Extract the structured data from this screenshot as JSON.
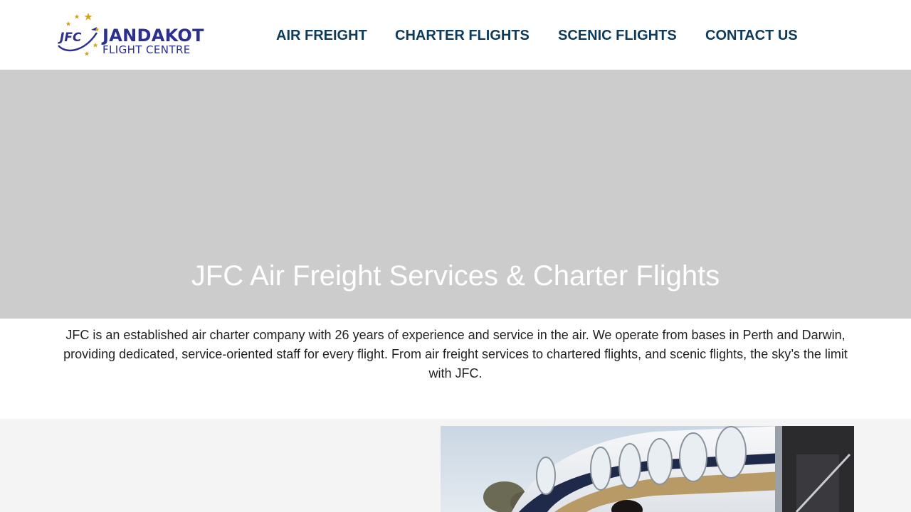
{
  "logo": {
    "text": "JFC",
    "name_line1": "JANDAKOT",
    "name_line2": "FLIGHT CENTRE"
  },
  "nav": [
    {
      "label": "AIR FREIGHT"
    },
    {
      "label": "CHARTER FLIGHTS"
    },
    {
      "label": "SCENIC FLIGHTS"
    },
    {
      "label": "CONTACT US"
    }
  ],
  "hero": {
    "title": "JFC Air Freight Services & Charter Flights"
  },
  "intro": {
    "text": "JFC is an established air charter company with 26 years of experience and service in the air. We operate from bases in Perth and Darwin, providing dedicated, service-oriented staff for every flight. From air freight services to chartered flights, and scenic flights, the sky’s the limit with JFC."
  },
  "colors": {
    "brand": "#2b2f8f",
    "nav_text": "#0e3a5c",
    "star": "#d4a017",
    "hero_bg": "#cccccc"
  }
}
